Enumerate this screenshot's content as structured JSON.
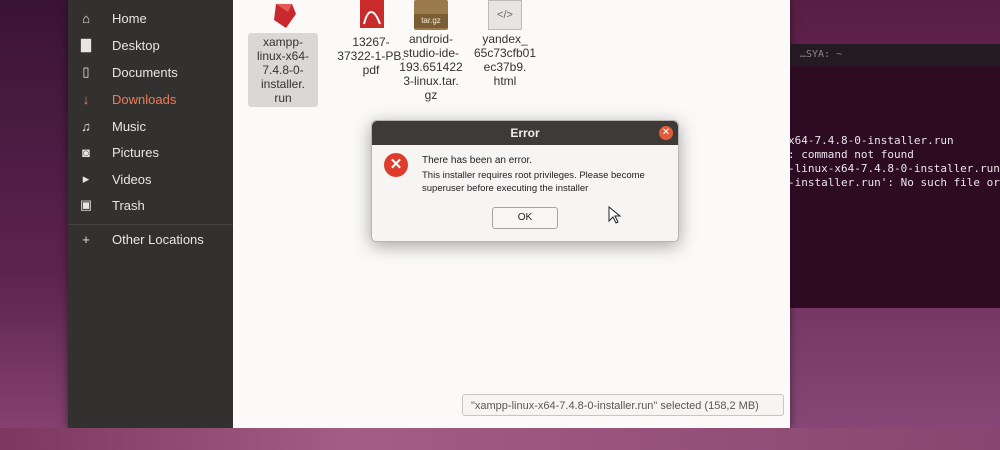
{
  "sidebar": {
    "items": [
      {
        "label": "Home",
        "icon": "home-icon",
        "glyph": "⌂"
      },
      {
        "label": "Desktop",
        "icon": "folder-icon",
        "glyph": "▇"
      },
      {
        "label": "Documents",
        "icon": "document-icon",
        "glyph": "▯"
      },
      {
        "label": "Downloads",
        "icon": "download-icon",
        "glyph": "↓"
      },
      {
        "label": "Music",
        "icon": "music-icon",
        "glyph": "♫"
      },
      {
        "label": "Pictures",
        "icon": "camera-icon",
        "glyph": "◙"
      },
      {
        "label": "Videos",
        "icon": "video-icon",
        "glyph": "▸"
      },
      {
        "label": "Trash",
        "icon": "trash-icon",
        "glyph": "▣"
      },
      {
        "label": "Other Locations",
        "icon": "plus-icon",
        "glyph": "+"
      }
    ],
    "active_index": 3
  },
  "files": [
    {
      "name_lines": [
        "xampp-",
        "linux-x64-",
        "7.4.8-0-",
        "installer.",
        "run"
      ],
      "selected": true,
      "icon": "run-file-icon"
    },
    {
      "name_lines": [
        "13267-",
        "37322-1-PB.",
        "pdf"
      ],
      "selected": false,
      "icon": "pdf-icon"
    },
    {
      "name_lines": [
        "android-",
        "studio-ide-",
        "193.651422",
        "3-linux.tar.",
        "gz"
      ],
      "selected": false,
      "icon": "archive-icon",
      "thumb_label": "tar.gz"
    },
    {
      "name_lines": [
        "yandex_",
        "65c73cfb01",
        "ec37b9.",
        "html"
      ],
      "selected": false,
      "icon": "html-icon",
      "thumb_label": "</>"
    }
  ],
  "status_bar": {
    "text": "\"xampp-linux-x64-7.4.8-0-installer.run\" selected  (158,2 MB)"
  },
  "terminal": {
    "title": "…SYA: ~",
    "lines": [
      "x64-7.4.8-0-installer.run",
      ": command not found",
      "-linux-x64-7.4.8-0-installer.run",
      "-installer.run': No such file or d"
    ]
  },
  "dialog": {
    "title": "Error",
    "heading": "There has been an error.",
    "body": "This installer requires root privileges. Please become superuser before executing the installer",
    "ok_label": "OK"
  },
  "colors": {
    "accent": "#ef7a59",
    "error_red": "#df3c2c",
    "sidebar_bg": "#333130"
  }
}
